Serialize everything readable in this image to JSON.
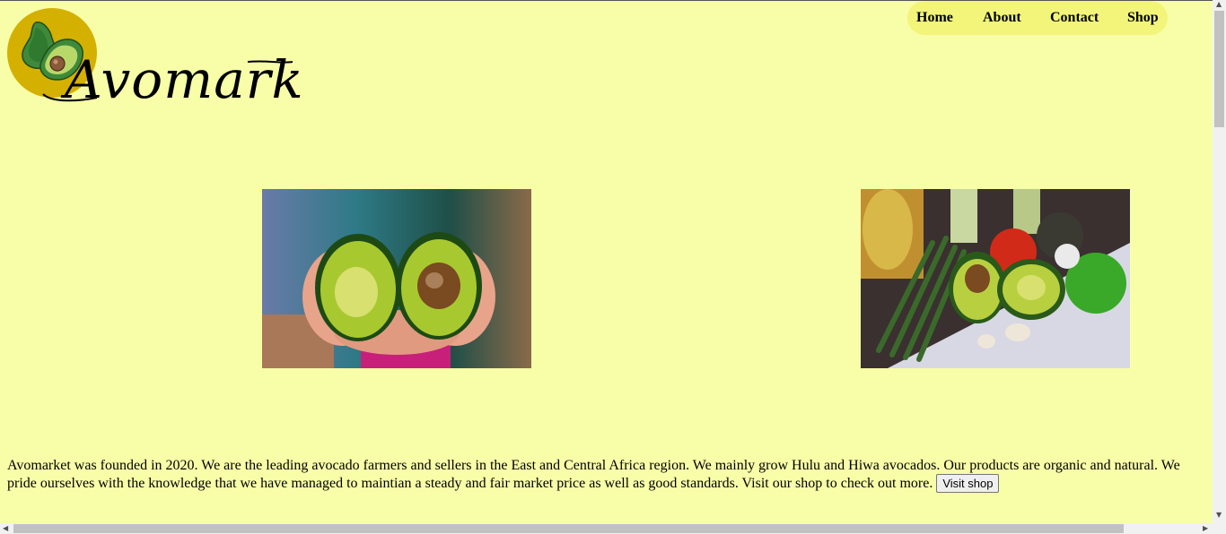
{
  "logo": {
    "text": "Avomarket"
  },
  "nav": {
    "items": [
      {
        "label": "Home"
      },
      {
        "label": "About"
      },
      {
        "label": "Contact"
      },
      {
        "label": "Shop"
      }
    ]
  },
  "images": [
    {
      "alt": "hands holding halved avocado"
    },
    {
      "alt": "avocado with vegetables"
    }
  ],
  "about": {
    "text": "Avomarket was founded in 2020. We are the leading avocado farmers and sellers in the East and Central Africa region. We mainly grow Hulu and Hiwa avocados. Our products are organic and natural. We pride ourselves with the knowledge that we have managed to maintian a steady and fair market price as well as good standards. Visit our shop to check out more.",
    "button_label": "Visit shop"
  },
  "colors": {
    "background": "#f8fda8",
    "nav_background": "#f2f57a"
  }
}
